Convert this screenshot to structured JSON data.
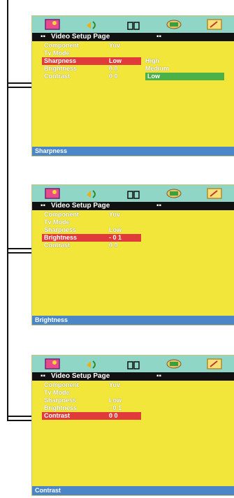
{
  "icons": [
    "picture-icon",
    "audio-icon",
    "dolby-icon",
    "speaker-icon",
    "preference-icon"
  ],
  "colors": {
    "iconbar": "#8fd6c6",
    "screen": "#f2e63a",
    "highlight": "#e03a3a",
    "selected_option": "#4db14a",
    "status": "#4a86c8"
  },
  "screens": [
    {
      "title_left_dots": "▪▪",
      "title": "Video Setup Page",
      "title_right_dots": "▪▪",
      "rows": [
        {
          "label": "Component",
          "value": "Yuv"
        },
        {
          "label": "Tv  Mode",
          "value": ""
        },
        {
          "label": "Sharpness",
          "value": "Low"
        },
        {
          "label": "Brightness",
          "value": "0 0"
        },
        {
          "label": "Contrast",
          "value": "0 0"
        }
      ],
      "options": [
        "High",
        "Medium",
        "Low"
      ],
      "status": "Sharpness"
    },
    {
      "title_left_dots": "▪▪",
      "title": "Video Setup Page",
      "title_right_dots": "▪▪",
      "rows": [
        {
          "label": "Component",
          "value": "Yuv"
        },
        {
          "label": "Tv  Mode",
          "value": ""
        },
        {
          "label": "Sharpness",
          "value": "Low"
        },
        {
          "label": "Brightness",
          "value": "- 0 1"
        },
        {
          "label": "Contrast",
          "value": "0 0"
        }
      ],
      "status": "Brightness"
    },
    {
      "title_left_dots": "▪▪",
      "title": "Video Setup Page",
      "title_right_dots": "▪▪",
      "rows": [
        {
          "label": "Component",
          "value": "Yuv"
        },
        {
          "label": "Tv  Mode",
          "value": ""
        },
        {
          "label": "Sharpness",
          "value": "Low"
        },
        {
          "label": "Brightness",
          "value": "- 0 1"
        },
        {
          "label": "Contrast",
          "value": "0 0"
        }
      ],
      "status": "Contrast"
    }
  ]
}
